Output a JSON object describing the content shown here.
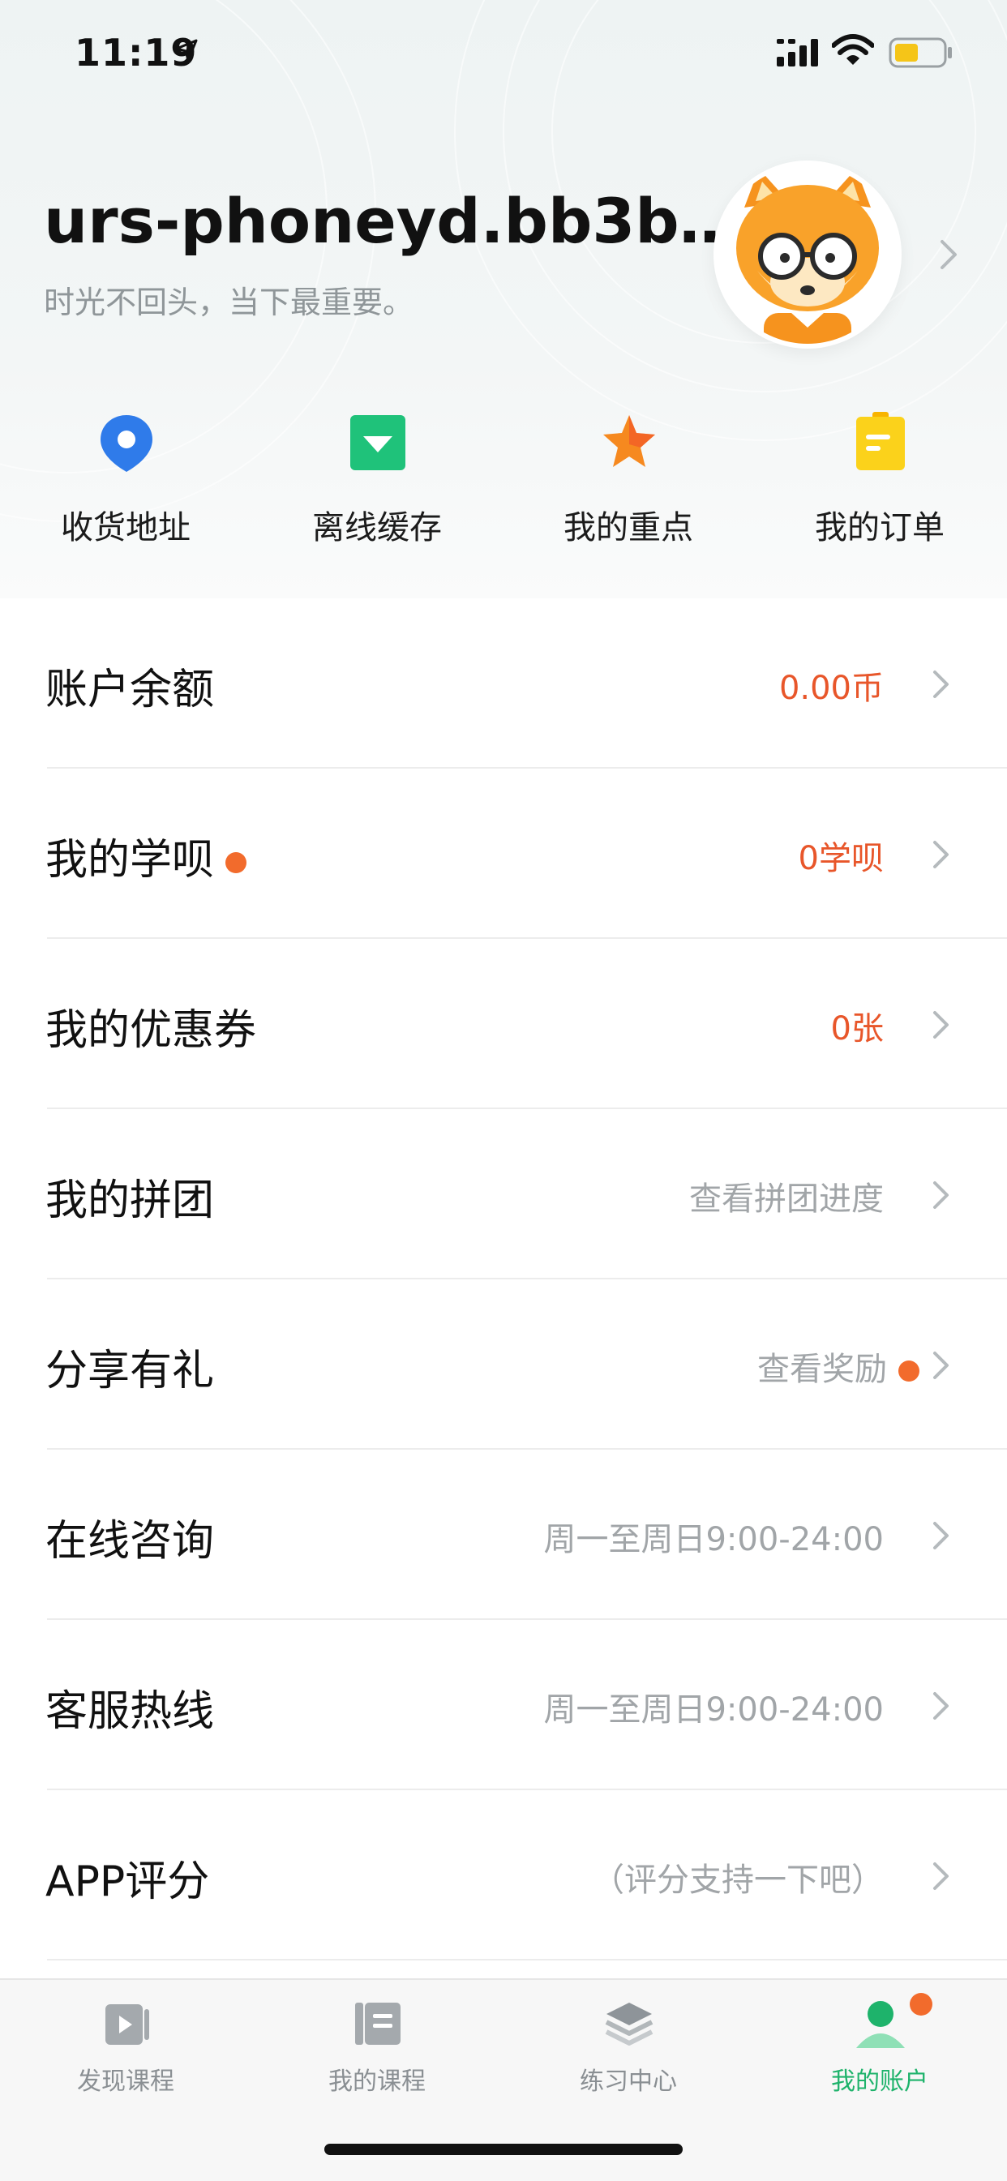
{
  "status_bar": {
    "time": "11:19",
    "icons": [
      "location-arrow-icon",
      "signal-icon",
      "wifi-icon",
      "battery-icon"
    ]
  },
  "profile": {
    "username": "urs-phoneyd.bb3b…",
    "motto": "时光不回头，当下最重要。",
    "avatar": "fox-avatar"
  },
  "quick_actions": [
    {
      "label": "收货地址",
      "icon": "location-pin-icon"
    },
    {
      "label": "离线缓存",
      "icon": "download-icon"
    },
    {
      "label": "我的重点",
      "icon": "star-icon"
    },
    {
      "label": "我的订单",
      "icon": "order-icon"
    }
  ],
  "list_items": [
    {
      "title": "账户余额",
      "value": "0.00币"
    },
    {
      "title": "我的学呗",
      "value": "0学呗"
    },
    {
      "title": "我的优惠券",
      "value": "0张"
    },
    {
      "title": "我的拼团",
      "value": "查看拼团进度"
    },
    {
      "title": "分享有礼",
      "value": "查看奖励"
    },
    {
      "title": "在线咨询",
      "value": "周一至周日9:00-24:00"
    },
    {
      "title": "客服热线",
      "value": "周一至周日9:00-24:00"
    },
    {
      "title": "APP评分",
      "value": "（评分支持一下吧）"
    }
  ],
  "tabs": [
    {
      "label": "发现课程",
      "icon": "play-icon"
    },
    {
      "label": "我的课程",
      "icon": "book-icon"
    },
    {
      "label": "练习中心",
      "icon": "layers-icon"
    },
    {
      "label": "我的账户",
      "icon": "user-icon",
      "active": true
    }
  ],
  "colors": {
    "accent_green": "#1eb36b",
    "accent_orange": "#e8562a",
    "badge_orange": "#f26b2c",
    "muted_gray": "#a1a5a8"
  }
}
